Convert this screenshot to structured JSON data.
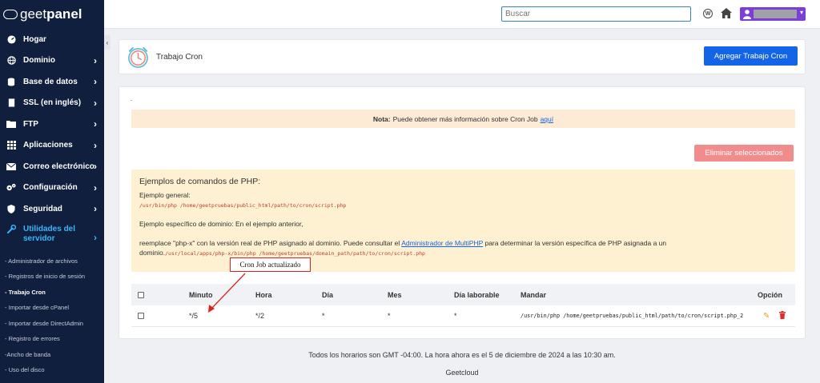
{
  "brand": {
    "name_light": "geet",
    "name_bold": "panel"
  },
  "sidebar": {
    "items": [
      {
        "label": "Hogar",
        "icon": "dashboard-icon",
        "has_chevron": false
      },
      {
        "label": "Dominio",
        "icon": "globe-icon",
        "has_chevron": true
      },
      {
        "label": "Base de datos",
        "icon": "database-icon",
        "has_chevron": true
      },
      {
        "label": "SSL (en inglés)",
        "icon": "file-icon",
        "has_chevron": true
      },
      {
        "label": "FTP",
        "icon": "folder-icon",
        "has_chevron": true
      },
      {
        "label": "Aplicaciones",
        "icon": "grid-icon",
        "has_chevron": true
      },
      {
        "label": "Correo electrónico",
        "icon": "envelope-icon",
        "has_chevron": true
      },
      {
        "label": "Configuración",
        "icon": "gears-icon",
        "has_chevron": true
      },
      {
        "label": "Seguridad",
        "icon": "shield-icon",
        "has_chevron": true
      }
    ],
    "active_item": {
      "label": "Utilidades del servidor",
      "icon": "wrench-icon"
    },
    "subitems": [
      "- Administrador de archivos",
      "- Registros de inicio de sesión",
      "- Trabajo Cron",
      "- Importar desde cPanel",
      "- Importar desde DirectAdmin",
      "- Registro de errores",
      "-Ancho de banda",
      "- Uso del disco"
    ],
    "current_subitem_index": 2
  },
  "topbar": {
    "search_placeholder": "Buscar"
  },
  "header": {
    "title": "Trabajo Cron",
    "add_button": "Agregar Trabajo Cron"
  },
  "main": {
    "dot": ".",
    "note": {
      "bold": "Nota:",
      "text": "Puede obtener más información sobre Cron Job",
      "link": "aquí"
    },
    "delete_button": "Eliminar seleccionados",
    "examples": {
      "title": "Ejemplos de comandos de PHP:",
      "general_label": "Ejemplo general:",
      "general_code": "/usr/bin/php /home/geetpruebas/public_html/path/to/cron/script.php",
      "specific_text": "Ejemplo específico de dominio: En el ejemplo anterior,",
      "replace_text_1": "reemplace \"php-x\" con la versión real de PHP asignado al dominio. Puede consultar el",
      "replace_link": "Administrador de MultiPHP",
      "replace_text_2": "para determinar la versión específica de PHP asignada a un",
      "replace_text_3": "dominio.",
      "specific_code": "/usr/local/apps/php-x/bin/php /home/geetpruebas/domain_path/path/to/cron/script.php"
    },
    "table": {
      "headers": [
        "Minuto",
        "Hora",
        "Día",
        "Mes",
        "Día laborable",
        "Mandar",
        "Opción"
      ],
      "rows": [
        {
          "minute": "*/5",
          "hour": "*/2",
          "day": "*",
          "month": "*",
          "weekday": "*",
          "command": "/usr/bin/php /home/geetpruebas/public_html/path/to/cron/script.php_2"
        }
      ]
    }
  },
  "annotation": {
    "label": "Cron Job actualizado",
    "color": "#d9231f"
  },
  "footer": {
    "timezone_text": "Todos los horarios son GMT -04:00. La hora ahora es el 5 de diciembre de 2024 a las 10:30 am.",
    "company": "Geetcloud"
  },
  "colors": {
    "sidebar_bg": "#0f1f3d",
    "accent_blue": "#1464e8",
    "active_blue": "#38b6ff",
    "user_purple": "#7b3fd6",
    "delete_red": "#f28c8c"
  }
}
